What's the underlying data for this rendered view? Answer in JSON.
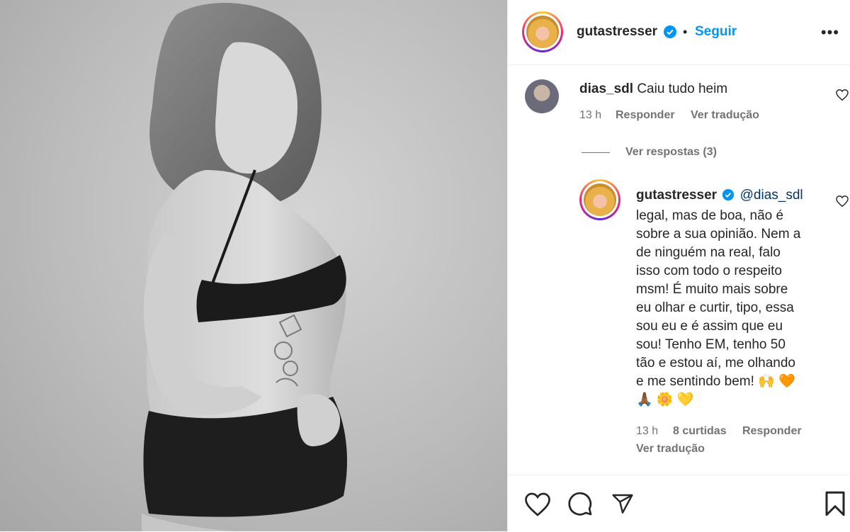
{
  "post": {
    "author": "gutastresser",
    "follow_label": "Seguir",
    "separator": "•",
    "more_label": "•••"
  },
  "comments": [
    {
      "username": "dias_sdl",
      "text": "Caiu tudo heim",
      "time": "13 h",
      "reply_label": "Responder",
      "translate_label": "Ver tradução",
      "view_replies_label": "Ver respostas (3)"
    }
  ],
  "reply": {
    "username": "gutastresser",
    "mention": "@dias_sdl",
    "lines": [
      "legal, mas de boa, não é",
      "sobre a sua opinião. Nem a",
      "de ninguém na real, falo",
      "isso com todo o respeito",
      "msm! É muito mais sobre",
      "eu olhar e curtir, tipo, essa",
      "sou eu e é assim que eu",
      "sou! Tenho EM, tenho 50",
      "tão e estou aí, me olhando",
      "e me sentindo bem! 🙌 🧡",
      "🙏🏾 🌼 💛"
    ],
    "time": "13 h",
    "likes_label": "8 curtidas",
    "reply_label": "Responder",
    "translate_label": "Ver tradução"
  },
  "icons": {
    "verified": "verified-badge-icon",
    "like": "heart-icon",
    "comment": "comment-icon",
    "share": "paper-plane-icon",
    "save": "bookmark-icon"
  },
  "colors": {
    "accent": "#0095f6",
    "mention": "#00376b",
    "muted": "#737373",
    "text": "#262626"
  }
}
